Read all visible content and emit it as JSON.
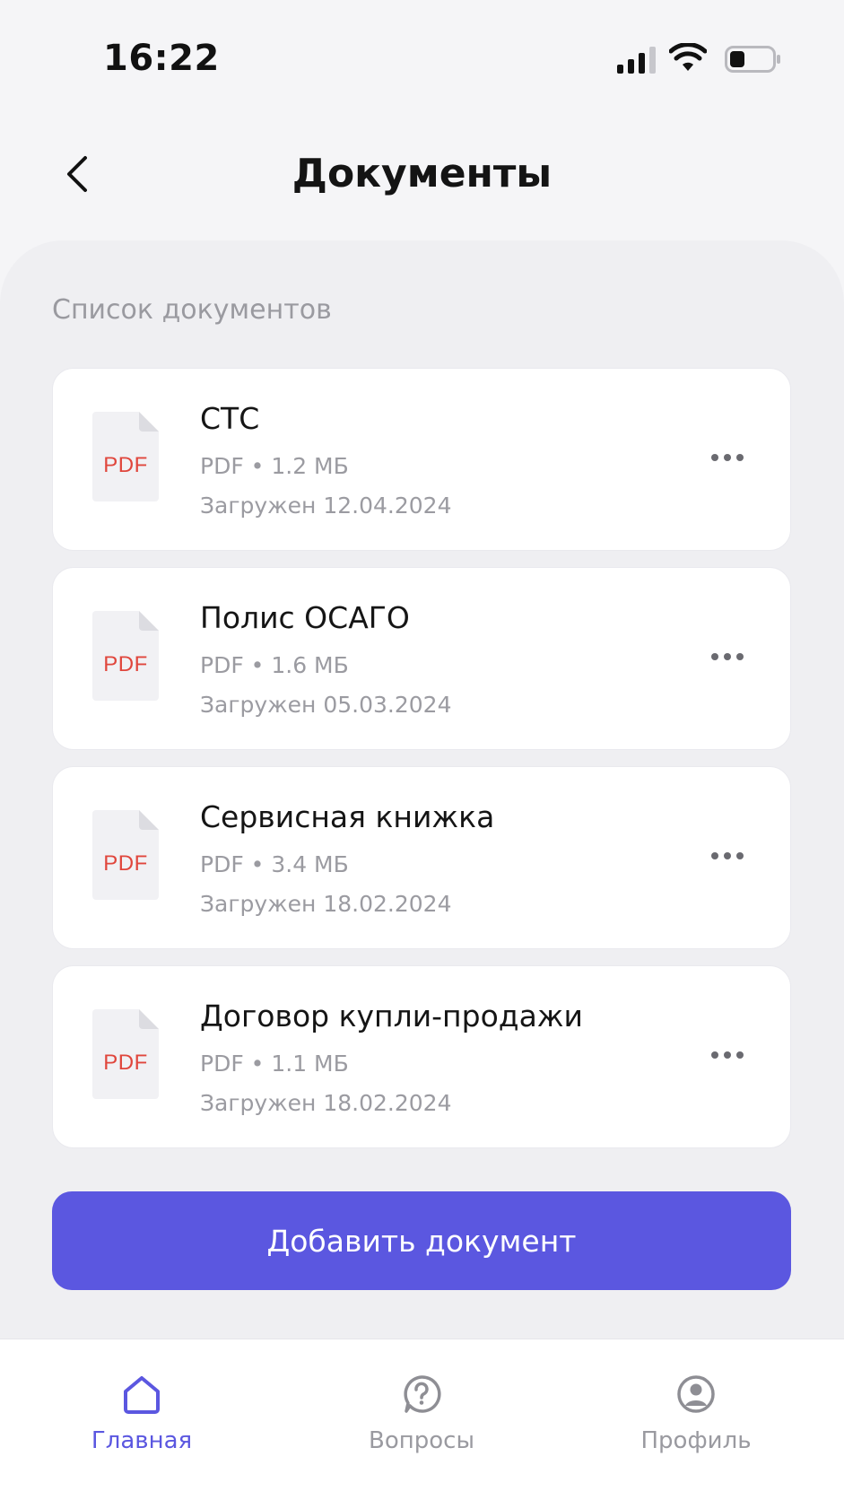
{
  "status_bar": {
    "time": "16:22"
  },
  "header": {
    "title": "Документы"
  },
  "section": {
    "label": "Список документов"
  },
  "documents": [
    {
      "name": "СТС",
      "type_label": "PDF",
      "meta": "PDF • 1.2 МБ",
      "uploaded": "Загружен 12.04.2024"
    },
    {
      "name": "Полис ОСАГО",
      "type_label": "PDF",
      "meta": "PDF • 1.6 МБ",
      "uploaded": "Загружен 05.03.2024"
    },
    {
      "name": "Сервисная книжка",
      "type_label": "PDF",
      "meta": "PDF • 3.4 МБ",
      "uploaded": "Загружен 18.02.2024"
    },
    {
      "name": "Договор купли-продажи",
      "type_label": "PDF",
      "meta": "PDF • 1.1 МБ",
      "uploaded": "Загружен 18.02.2024"
    }
  ],
  "actions": {
    "add_document": "Добавить документ"
  },
  "nav": {
    "items": [
      {
        "label": "Главная",
        "icon": "home-icon",
        "active": true
      },
      {
        "label": "Вопросы",
        "icon": "question-icon",
        "active": false
      },
      {
        "label": "Профиль",
        "icon": "profile-icon",
        "active": false
      }
    ]
  },
  "colors": {
    "accent": "#5b57e0",
    "pdf_red": "#e0463c",
    "muted_text": "#9b9ba1"
  }
}
